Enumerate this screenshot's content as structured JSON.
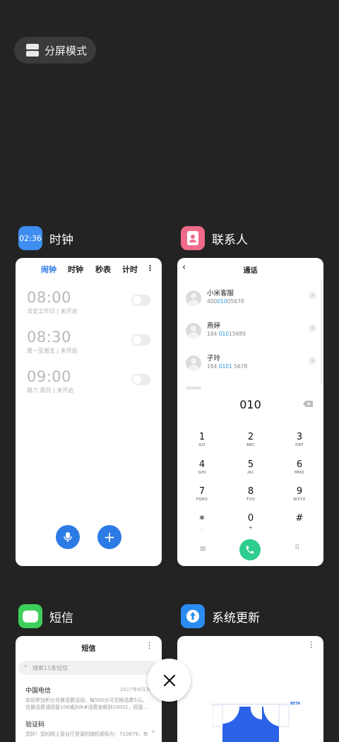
{
  "split_mode": {
    "label": "分屏模式"
  },
  "apps": {
    "clock": {
      "name": "时钟",
      "icon_text": "02:36",
      "tabs": [
        "闹钟",
        "时钟",
        "秒表",
        "计时"
      ],
      "alarms": [
        {
          "time": "08:00",
          "sub": "法定工作日 | 未开启"
        },
        {
          "time": "08:30",
          "sub": "周一至周五 | 未开启"
        },
        {
          "time": "09:00",
          "sub": "周六 周日 | 未开启"
        }
      ]
    },
    "contacts": {
      "name": "联系人",
      "title": "通话",
      "list": [
        {
          "name": "小米客服",
          "num_a": "400",
          "num_hl": "010",
          "num_b": "05678"
        },
        {
          "name": "燕婷",
          "num_a": "184 ",
          "num_hl": "010",
          "num_b": "15689"
        },
        {
          "name": "子玲",
          "num_a": "184 ",
          "num_hl": "0101",
          "num_b": " 5678"
        }
      ],
      "dialed": "010",
      "keypad": [
        {
          "d": "1",
          "l": "GO"
        },
        {
          "d": "2",
          "l": "ABC"
        },
        {
          "d": "3",
          "l": "DEF"
        },
        {
          "d": "4",
          "l": "GHI"
        },
        {
          "d": "5",
          "l": "JKL"
        },
        {
          "d": "6",
          "l": "MNO"
        },
        {
          "d": "7",
          "l": "PQRS"
        },
        {
          "d": "8",
          "l": "TUV"
        },
        {
          "d": "9",
          "l": "WXYZ"
        },
        {
          "d": "*",
          "l": ","
        },
        {
          "d": "0",
          "l": "+"
        },
        {
          "d": "#",
          "l": ""
        }
      ]
    },
    "sms": {
      "name": "短信",
      "title": "短信",
      "search_placeholder": "搜索11条短信",
      "messages": [
        {
          "title": "中国电信",
          "date": "2017年6月30",
          "body1": "欢迎参加积分兑换话费活动，每500分可兑换话费5元。",
          "body2": "兑换话费请回复106或jfdh#话费金额到10001，回复..."
        },
        {
          "title": "验证码",
          "date": "",
          "body1": "您好！您的网上营业厅登录的随机密码为：710679，有",
          "body2": ""
        }
      ]
    },
    "update": {
      "name": "系统更新",
      "badge": "BETA"
    }
  },
  "colors": {
    "accent": "#2c7be5",
    "call_green": "#2ecc8f",
    "background": "#232323"
  }
}
